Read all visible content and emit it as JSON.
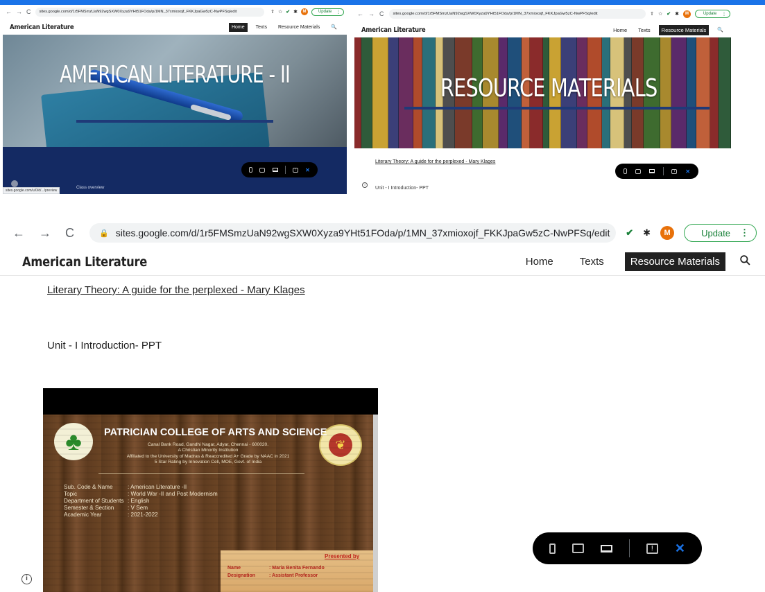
{
  "colors": {
    "accent_blue": "#1a73e8",
    "navy_band": "#142a63",
    "rule_navy": "#1f3a78",
    "update_green": "#188038",
    "avatar_orange": "#e8710a",
    "menu_active_bg": "#212121",
    "slide_red": "#c0241c"
  },
  "icons": {
    "back": "←",
    "forward": "→",
    "reload": "C",
    "lock": "🔒",
    "share": "⇧",
    "star": "☆",
    "check": "✔",
    "puzzle": "✱",
    "menu_dots": "⋮",
    "search": "🔍",
    "close": "✕",
    "info": "i",
    "feedback": "!",
    "clover": "♣",
    "emblem": "❦"
  },
  "browser": {
    "url": "sites.google.com/d/1r5FMSmzUaN92wgSXW0Xyza9YHt51FOda/p/1MN_37xmioxojf_FKKJpaGw5zC-NwPFSq/edit",
    "avatar_letter": "M",
    "update_label": "Update"
  },
  "site": {
    "brand": "American Literature",
    "nav": [
      "Home",
      "Texts",
      "Resource Materials"
    ]
  },
  "panel1": {
    "hero_title": "AMERICAN LITERATURE - II",
    "peek_text": "Class overview",
    "status_url": "sites.google.com/u/0/d/.../preview"
  },
  "panel2": {
    "hero_title": "RESOURCE MATERIALS",
    "link_text": "Literary Theory: A guide for the perplexed - Mary Klages",
    "unit_text": "Unit - I Introduction- PPT"
  },
  "main": {
    "link_text": "Literary Theory: A guide for the perplexed - Mary Klages",
    "unit_text": "Unit - I Introduction- PPT"
  },
  "slide": {
    "college": "PATRICIAN COLLEGE OF ARTS AND SCIENCE",
    "address_lines": [
      "Canal Bank Road, Gandhi Nagar, Adyar, Chennai - 600020.",
      "A Christian Minority Institution",
      "Affiliated to the University of Madras & Reaccredited A+ Grade by NAAC in 2021",
      "5 Star Rating by Innovation Cell, MOE, Govt. of India"
    ],
    "details": [
      {
        "k": "Sub. Code & Name",
        "v": ": American Literature -II"
      },
      {
        "k": "Topic",
        "v": ": World War -II and Post Modernism"
      },
      {
        "k": "Department of Students",
        "v": ": English"
      },
      {
        "k": "Semester & Section",
        "v": ": V Sem"
      },
      {
        "k": "Academic Year",
        "v": ": 2021-2022"
      }
    ],
    "presented_by": "Presented by",
    "name_label": "Name",
    "name_value": ": Maria Benita Fernando",
    "designation_label": "Designation",
    "designation_value": ": Assistant Professor"
  }
}
